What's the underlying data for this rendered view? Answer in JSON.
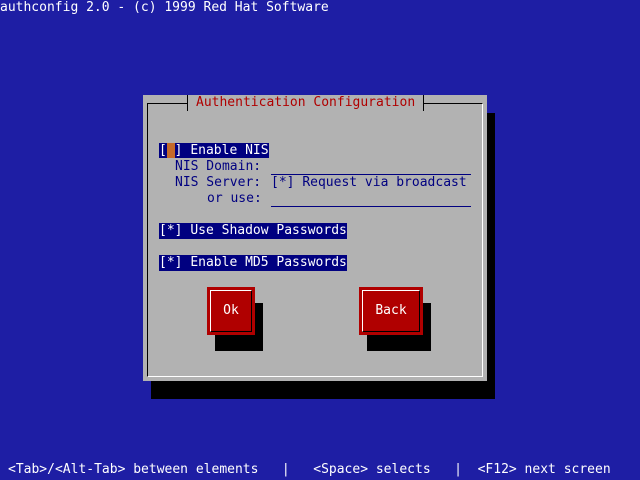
{
  "header": {
    "title": "authconfig 2.0 - (c) 1999 Red Hat Software"
  },
  "dialog": {
    "title": "Authentication Configuration",
    "enable_nis": {
      "checkbox": "[ ]",
      "label": "Enable NIS",
      "checked": false
    },
    "nis_domain": {
      "label": "NIS Domain:",
      "value": ""
    },
    "nis_server": {
      "label": "NIS Server:",
      "broadcast_checkbox": "[*]",
      "broadcast_label": "Request via broadcast"
    },
    "or_use": {
      "label": "or use:",
      "value": ""
    },
    "shadow_passwords": {
      "checkbox": "[*]",
      "label": "Use Shadow Passwords",
      "checked": true
    },
    "md5_passwords": {
      "checkbox": "[*]",
      "label": "Enable MD5 Passwords",
      "checked": true
    },
    "ok_label": "Ok",
    "back_label": "Back"
  },
  "status_bar": {
    "text": "<Tab>/<Alt-Tab> between elements   |   <Space> selects   |  <F12> next screen"
  },
  "colors": {
    "background": "#1e1ea4",
    "dialog": "#b2b2b2",
    "title_text": "#b00000",
    "button": "#b00000",
    "highlight": "#000080"
  }
}
